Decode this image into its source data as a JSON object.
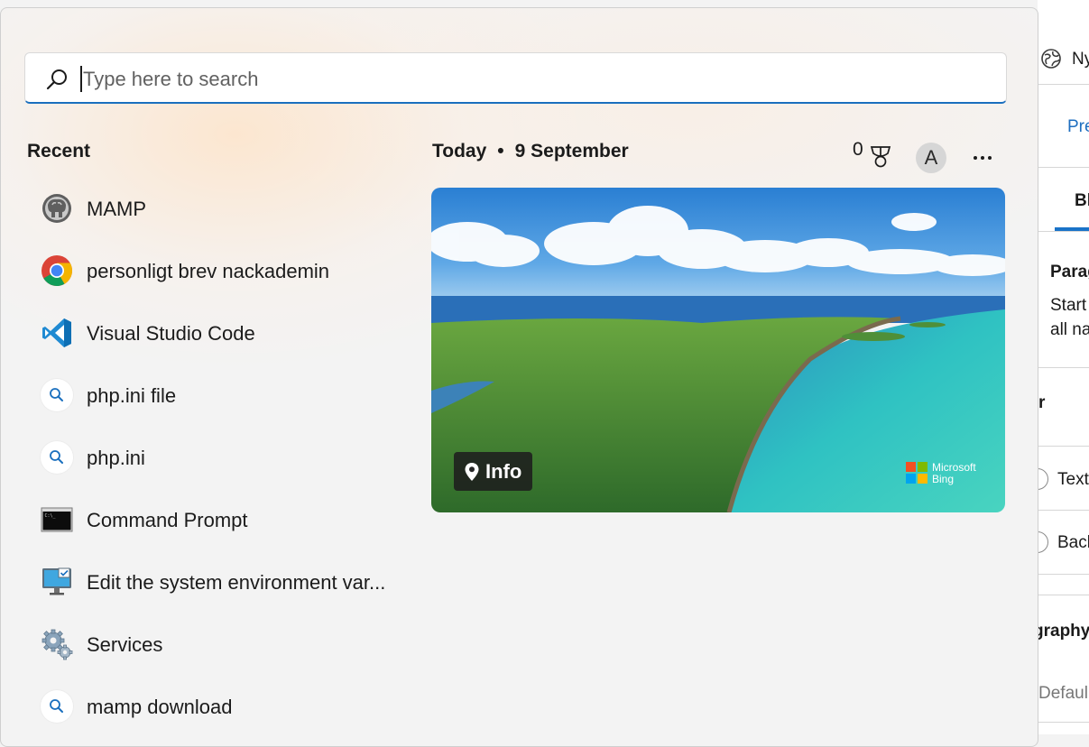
{
  "background_app": {
    "tab_new": "Ny",
    "link_preview": "Pre",
    "tab_bl": "Bl",
    "paragraph_heading": "Parag",
    "paragraph_text_1": "Start",
    "paragraph_text_2": "all na",
    "row_r": "r",
    "option_text": "Text",
    "option_back": "Back",
    "typography_heading": "graphy",
    "default_label": "Defaul"
  },
  "search": {
    "placeholder": "Type here to search",
    "value": ""
  },
  "recent": {
    "heading": "Recent",
    "items": [
      {
        "label": "MAMP",
        "icon": "mamp-elephant-icon"
      },
      {
        "label": "personligt brev nackademin",
        "icon": "chrome-icon"
      },
      {
        "label": "Visual Studio Code",
        "icon": "vscode-icon"
      },
      {
        "label": "php.ini file",
        "icon": "search-icon"
      },
      {
        "label": "php.ini",
        "icon": "search-icon"
      },
      {
        "label": "Command Prompt",
        "icon": "command-prompt-icon"
      },
      {
        "label": "Edit the system environment var...",
        "icon": "system-properties-icon"
      },
      {
        "label": "Services",
        "icon": "services-gears-icon"
      },
      {
        "label": "mamp download",
        "icon": "search-icon"
      }
    ]
  },
  "today": {
    "label": "Today",
    "separator": "•",
    "date": "9 September",
    "points": "0",
    "avatar_initial": "A"
  },
  "hero": {
    "info_label": "Info",
    "brand_line1": "Microsoft",
    "brand_line2": "Bing"
  },
  "colors": {
    "accent": "#1a6fbe",
    "panel_bg": "#f3f3f3"
  }
}
